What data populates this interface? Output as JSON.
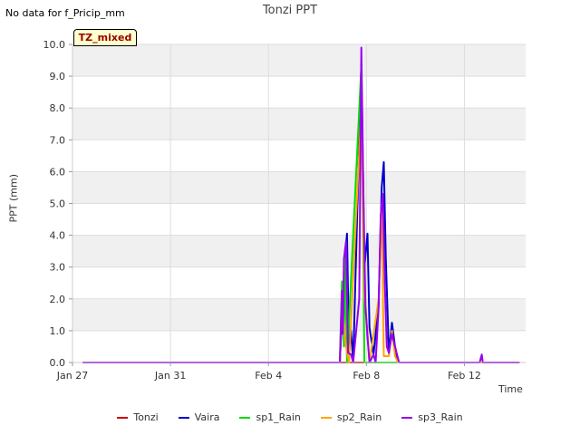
{
  "header": {
    "nodata": "No data for f_Pricip_mm",
    "title": "Tonzi PPT",
    "tz": "TZ_mixed"
  },
  "chart_data": {
    "type": "line",
    "title": "Tonzi PPT",
    "ylabel": "PPT (mm)",
    "xlabel": "Time",
    "ylim": [
      0,
      10
    ],
    "xlim": [
      "2025-01-27T00:00",
      "2025-02-14T12:00"
    ],
    "yticks": [
      "0.0",
      "1.0",
      "2.0",
      "3.0",
      "4.0",
      "5.0",
      "6.0",
      "7.0",
      "8.0",
      "9.0",
      "10.0"
    ],
    "xticks": [
      {
        "label": "Jan 27",
        "t": "2025-01-27T00:00"
      },
      {
        "label": "Jan 31",
        "t": "2025-01-31T00:00"
      },
      {
        "label": "Feb 4",
        "t": "2025-02-04T00:00"
      },
      {
        "label": "Feb 8",
        "t": "2025-02-08T00:00"
      },
      {
        "label": "Feb 12",
        "t": "2025-02-12T00:00"
      }
    ],
    "grid": true,
    "legend_position": "bottom",
    "series": [
      {
        "name": "Tonzi",
        "color": "#cc0000",
        "points": [
          [
            "2025-01-27T10:00",
            0
          ],
          [
            "2025-02-14T06:00",
            0
          ]
        ]
      },
      {
        "name": "Vaira",
        "color": "#0000cc",
        "points": [
          [
            "2025-01-27T10:00",
            0
          ],
          [
            "2025-02-06T22:00",
            0
          ],
          [
            "2025-02-07T01:00",
            2.0
          ],
          [
            "2025-02-07T03:00",
            3.3
          ],
          [
            "2025-02-07T05:00",
            4.05
          ],
          [
            "2025-02-07T07:00",
            0.3
          ],
          [
            "2025-02-07T09:00",
            1.0
          ],
          [
            "2025-02-07T11:00",
            0
          ],
          [
            "2025-02-07T19:00",
            9.4
          ],
          [
            "2025-02-07T22:00",
            3.0
          ],
          [
            "2025-02-08T01:00",
            4.05
          ],
          [
            "2025-02-08T03:00",
            1.1
          ],
          [
            "2025-02-08T07:00",
            0.25
          ],
          [
            "2025-02-08T12:00",
            1.8
          ],
          [
            "2025-02-08T15:00",
            5.5
          ],
          [
            "2025-02-08T17:00",
            6.3
          ],
          [
            "2025-02-08T19:00",
            3.3
          ],
          [
            "2025-02-08T22:00",
            0.3
          ],
          [
            "2025-02-09T01:00",
            1.25
          ],
          [
            "2025-02-09T04:00",
            0.5
          ],
          [
            "2025-02-09T07:00",
            0
          ],
          [
            "2025-02-14T06:00",
            0
          ]
        ]
      },
      {
        "name": "sp1_Rain",
        "color": "#00dd00",
        "points": [
          [
            "2025-01-27T10:00",
            0
          ],
          [
            "2025-02-06T22:00",
            0
          ],
          [
            "2025-02-07T00:00",
            2.55
          ],
          [
            "2025-02-07T02:00",
            0.5
          ],
          [
            "2025-02-07T03:00",
            3.55
          ],
          [
            "2025-02-07T05:00",
            0
          ],
          [
            "2025-02-07T19:00",
            9.3
          ],
          [
            "2025-02-07T22:00",
            0
          ],
          [
            "2025-02-14T06:00",
            0
          ]
        ]
      },
      {
        "name": "sp2_Rain",
        "color": "#ffa500",
        "points": [
          [
            "2025-01-27T10:00",
            0
          ],
          [
            "2025-02-06T22:00",
            0
          ],
          [
            "2025-02-07T00:00",
            2.0
          ],
          [
            "2025-02-07T03:00",
            0.7
          ],
          [
            "2025-02-07T05:00",
            0.3
          ],
          [
            "2025-02-07T07:00",
            0
          ],
          [
            "2025-02-07T19:00",
            8.0
          ],
          [
            "2025-02-07T22:00",
            2.0
          ],
          [
            "2025-02-08T01:00",
            1.0
          ],
          [
            "2025-02-08T03:00",
            0
          ],
          [
            "2025-02-08T12:00",
            2.0
          ],
          [
            "2025-02-08T15:00",
            5.0
          ],
          [
            "2025-02-08T17:00",
            0.2
          ],
          [
            "2025-02-08T22:00",
            0.2
          ],
          [
            "2025-02-09T01:00",
            1.0
          ],
          [
            "2025-02-09T04:00",
            0.2
          ],
          [
            "2025-02-09T07:00",
            0
          ],
          [
            "2025-02-14T06:00",
            0
          ]
        ]
      },
      {
        "name": "sp3_Rain",
        "color": "#9900ee",
        "points": [
          [
            "2025-01-27T10:00",
            0
          ],
          [
            "2025-02-06T22:00",
            0
          ],
          [
            "2025-02-07T00:00",
            2.25
          ],
          [
            "2025-02-07T01:00",
            0.9
          ],
          [
            "2025-02-07T02:00",
            3.25
          ],
          [
            "2025-02-07T04:00",
            3.8
          ],
          [
            "2025-02-07T06:00",
            0.3
          ],
          [
            "2025-02-07T09:00",
            0.25
          ],
          [
            "2025-02-07T11:00",
            0
          ],
          [
            "2025-02-07T17:00",
            2.0
          ],
          [
            "2025-02-07T19:00",
            9.9
          ],
          [
            "2025-02-07T21:00",
            5.5
          ],
          [
            "2025-02-07T23:00",
            1.8
          ],
          [
            "2025-02-08T01:00",
            0.8
          ],
          [
            "2025-02-08T03:00",
            0
          ],
          [
            "2025-02-08T07:00",
            0.25
          ],
          [
            "2025-02-08T09:00",
            0
          ],
          [
            "2025-02-08T12:00",
            1.75
          ],
          [
            "2025-02-08T14:00",
            4.6
          ],
          [
            "2025-02-08T16:00",
            5.3
          ],
          [
            "2025-02-08T18:00",
            2.5
          ],
          [
            "2025-02-08T20:00",
            0.5
          ],
          [
            "2025-02-08T22:00",
            0.3
          ],
          [
            "2025-02-09T01:00",
            0.9
          ],
          [
            "2025-02-09T04:00",
            0.5
          ],
          [
            "2025-02-09T06:00",
            0.25
          ],
          [
            "2025-02-09T08:00",
            0
          ],
          [
            "2025-02-12T15:00",
            0
          ],
          [
            "2025-02-12T17:00",
            0.25
          ],
          [
            "2025-02-12T18:00",
            0
          ],
          [
            "2025-02-14T06:00",
            0
          ]
        ]
      }
    ]
  }
}
